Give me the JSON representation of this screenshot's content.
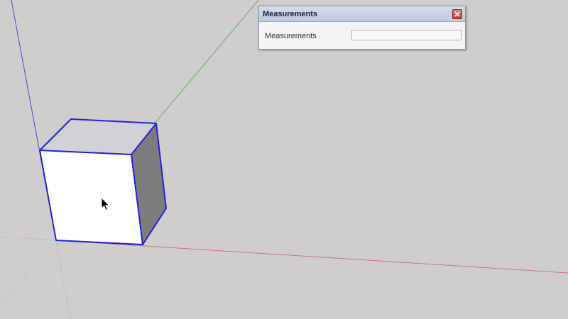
{
  "panel": {
    "title": "Measurements",
    "field_label": "Measurements",
    "field_value": "",
    "close_icon": "close-icon"
  },
  "viewport": {
    "background": "#cfcecd",
    "axes": {
      "red": "#c87878",
      "green": "#5cb45c",
      "blue": "#4b4bd2"
    },
    "selection_color": "#2020e6",
    "cursor_icon": "arrow-cursor-icon"
  }
}
